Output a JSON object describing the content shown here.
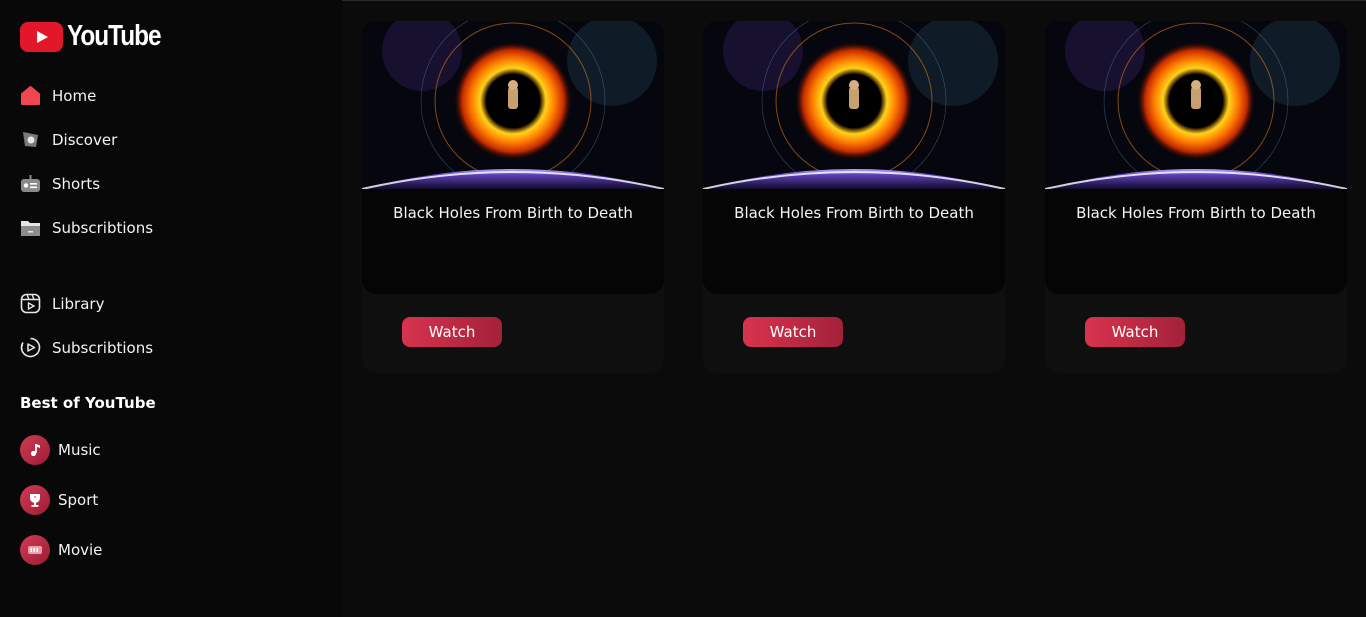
{
  "app": {
    "logo_text": "YouTube"
  },
  "sidebar": {
    "nav": [
      {
        "label": "Home",
        "icon": "home-icon"
      },
      {
        "label": "Discover",
        "icon": "compass-icon"
      },
      {
        "label": "Shorts",
        "icon": "shorts-icon"
      },
      {
        "label": "Subscribtions",
        "icon": "folder-icon"
      }
    ],
    "nav2": [
      {
        "label": "Library",
        "icon": "library-icon"
      },
      {
        "label": "Subscribtions",
        "icon": "play-circle-icon"
      }
    ],
    "best_title": "Best of YouTube",
    "categories": [
      {
        "label": "Music",
        "icon": "music-note-icon"
      },
      {
        "label": "Sport",
        "icon": "trophy-icon"
      },
      {
        "label": "Movie",
        "icon": "film-icon"
      }
    ]
  },
  "videos": [
    {
      "title": "Black Holes From Birth to Death",
      "button": "Watch"
    },
    {
      "title": "Black Holes From Birth to Death",
      "button": "Watch"
    },
    {
      "title": "Black Holes From Birth to Death",
      "button": "Watch"
    }
  ],
  "colors": {
    "accent": "#d8334f",
    "logo_red": "#e3172a",
    "background": "#0b0b0b"
  }
}
